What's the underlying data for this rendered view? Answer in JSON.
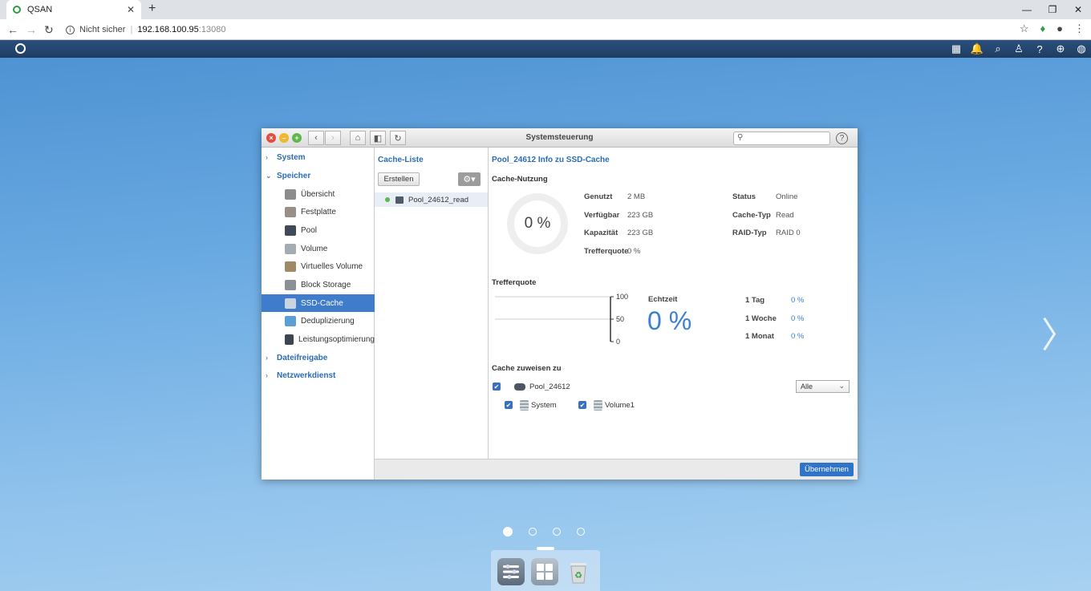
{
  "browser": {
    "tab_title": "QSAN",
    "tab_close": "✕",
    "new_tab": "+",
    "security": "Nicht sicher",
    "host": "192.168.100.95",
    "port": ":13080"
  },
  "window": {
    "title": "Systemsteuerung",
    "search_placeholder": "",
    "help": "?"
  },
  "sidebar": {
    "groups": [
      {
        "label": "System"
      },
      {
        "label": "Speicher"
      },
      {
        "label": "Dateifreigabe"
      },
      {
        "label": "Netzwerkdienst"
      }
    ],
    "items": [
      {
        "label": "Übersicht",
        "icon": "overview-icon",
        "color": "#8c8c8c"
      },
      {
        "label": "Festplatte",
        "icon": "disk-icon",
        "color": "#9a8f86"
      },
      {
        "label": "Pool",
        "icon": "pool-icon",
        "color": "#3e4a58"
      },
      {
        "label": "Volume",
        "icon": "volume-icon",
        "color": "#a4acb4"
      },
      {
        "label": "Virtuelles Volume",
        "icon": "virtual-volume-icon",
        "color": "#a08a66"
      },
      {
        "label": "Block Storage",
        "icon": "block-storage-icon",
        "color": "#8a9096"
      },
      {
        "label": "SSD-Cache",
        "icon": "ssd-cache-icon",
        "color": "#c9d4e0"
      },
      {
        "label": "Deduplizierung",
        "icon": "deduplication-icon",
        "color": "#5aa0d8"
      },
      {
        "label": "Leistungsoptimierung",
        "icon": "performance-icon",
        "color": "#3d4650"
      }
    ]
  },
  "list": {
    "title": "Cache-Liste",
    "create": "Erstellen",
    "gear": "⚙▾",
    "item": "Pool_24612_read"
  },
  "detail": {
    "title": "Pool_24612 Info zu SSD-Cache",
    "usage_title": "Cache-Nutzung",
    "donut_value": "0 %",
    "stats": [
      {
        "label": "Genutzt",
        "value": "2 MB"
      },
      {
        "label": "Verfügbar",
        "value": "223 GB"
      },
      {
        "label": "Kapazität",
        "value": "223 GB"
      },
      {
        "label": "Trefferquote",
        "value": "0 %"
      }
    ],
    "status": [
      {
        "label": "Status",
        "value": "Online"
      },
      {
        "label": "Cache-Typ",
        "value": "Read"
      },
      {
        "label": "RAID-Typ",
        "value": "RAID 0"
      }
    ],
    "hit_title": "Trefferquote",
    "realtime_label": "Echtzeit",
    "realtime_value": "0 %",
    "periods": [
      {
        "label": "1 Tag",
        "value": "0 %"
      },
      {
        "label": "1 Woche",
        "value": "0 %"
      },
      {
        "label": "1 Monat",
        "value": "0 %"
      }
    ],
    "assign_title": "Cache zuweisen zu",
    "pool": "Pool_24612",
    "volumes": [
      "System",
      "Volume1"
    ],
    "select_value": "Alle",
    "apply": "Übernehmen"
  },
  "chart_data": {
    "type": "line",
    "title": "",
    "xlabel": "",
    "ylabel": "",
    "ylim": [
      0,
      100
    ],
    "y_ticks": [
      100,
      50,
      0
    ],
    "series": [
      {
        "values": []
      }
    ],
    "grid": true
  },
  "pager": {
    "pages": 4,
    "active": 0
  }
}
